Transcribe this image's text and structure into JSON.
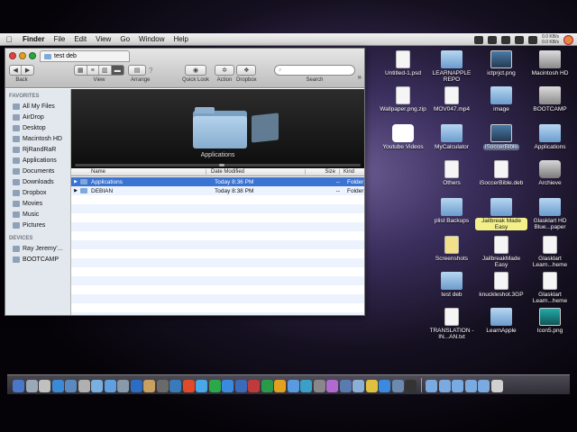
{
  "menubar": {
    "apple": "",
    "items": [
      "Finder",
      "File",
      "Edit",
      "View",
      "Go",
      "Window",
      "Help"
    ],
    "net_up": "0.0 KB/s",
    "net_down": "0.0 KB/s"
  },
  "window": {
    "tab_title": "test deb",
    "tab_add": "+",
    "toolbar": {
      "back_label": "Back",
      "back_prev": "◀",
      "back_next": "▶",
      "view_label": "View",
      "arrange_label": "Arrange",
      "arrange_help": "?",
      "quicklook_label": "Quick Look",
      "action_label": "Action",
      "dropbox_label": "Dropbox",
      "search_label": "Search",
      "search_placeholder": "",
      "overflow": "»"
    },
    "sidebar": {
      "favorites_heading": "FAVORITES",
      "favorites": [
        "All My Files",
        "AirDrop",
        "Desktop",
        "Macintosh HD",
        "RjRandRaR",
        "Applications",
        "Documents",
        "Downloads",
        "Dropbox",
        "Movies",
        "Music",
        "Pictures"
      ],
      "devices_heading": "DEVICES",
      "devices": [
        "Ray Jeremy'...",
        "BOOTCAMP"
      ]
    },
    "coverflow": {
      "label": "Applications"
    },
    "columns": {
      "name": "Name",
      "date": "Date Modified",
      "size": "Size",
      "kind": "Kind"
    },
    "rows": [
      {
        "name": "Applications",
        "date": "Today 8:36 PM",
        "size": "--",
        "kind": "Folder",
        "selected": true
      },
      {
        "name": "DEBIAN",
        "date": "Today 8:38 PM",
        "size": "--",
        "kind": "Folder",
        "selected": false
      }
    ]
  },
  "desktop": {
    "icons": [
      {
        "label": "Untitled-1.psd",
        "type": "file"
      },
      {
        "label": "LEARNAPPLE REPO",
        "type": "folder"
      },
      {
        "label": "ictprjct.png",
        "type": "img"
      },
      {
        "label": "Macintosh HD",
        "type": "drive"
      },
      {
        "label": "Wallpaper.png.zip",
        "type": "file"
      },
      {
        "label": "MOV047.mp4",
        "type": "file"
      },
      {
        "label": "image",
        "type": "folder"
      },
      {
        "label": "BOOTCAMP",
        "type": "drive"
      },
      {
        "label": "Youtube Videos",
        "type": "app"
      },
      {
        "label": "MyCalculator",
        "type": "folder"
      },
      {
        "label": "iSoccerBible",
        "type": "img"
      },
      {
        "label": "Applications",
        "type": "folder"
      },
      {
        "label": "Others",
        "type": "file"
      },
      {
        "label": "iSoccerBible.deb",
        "type": "file"
      },
      {
        "label": "Archieve",
        "type": "app"
      },
      {
        "label": "plist Backups",
        "type": "folder"
      },
      {
        "label": "Jailbreak Made Easy",
        "type": "folder"
      },
      {
        "label": "Glasklart HD Blue...paper",
        "type": "folder"
      },
      {
        "label": "Screenshots",
        "type": "folder"
      },
      {
        "label": "JailbreakMade Easy",
        "type": "file"
      },
      {
        "label": "Glasklart Learn...heme",
        "type": "file"
      },
      {
        "label": "test deb",
        "type": "folder"
      },
      {
        "label": "knuckleshot.3GP",
        "type": "file"
      },
      {
        "label": "Glasklart Learn...heme",
        "type": "file"
      },
      {
        "label": "TRANSLATION - IN...AN.txt",
        "type": "file"
      },
      {
        "label": "LearnApple",
        "type": "folder"
      },
      {
        "label": "Icon5.png",
        "type": "img"
      }
    ]
  },
  "colors": {
    "selection": "#3a73d2",
    "sidebar_bg": "#e3e8ee",
    "label_highlight": "#f3f08a"
  }
}
